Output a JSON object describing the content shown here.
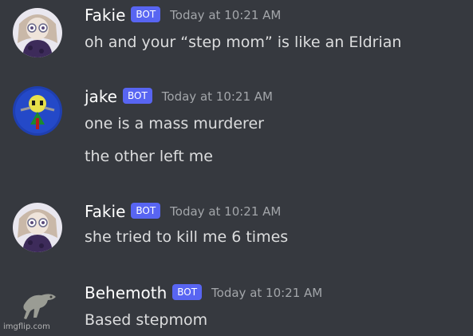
{
  "colors": {
    "background": "#36393f",
    "bot_tag": "#5865f2",
    "username": "#ffffff",
    "message_text": "#dcddde",
    "timestamp": "#a3a6aa"
  },
  "messages": [
    {
      "username": "Fakie",
      "tag": "BOT",
      "timestamp": "Today at 10:21 AM",
      "avatar": "fakie-avatar",
      "lines": [
        "oh and your “step mom” is like an Eldrian"
      ]
    },
    {
      "username": "jake",
      "tag": "BOT",
      "timestamp": "Today at 10:21 AM",
      "avatar": "jake-avatar",
      "lines": [
        "one is a mass murderer",
        "the other left me"
      ]
    },
    {
      "username": "Fakie",
      "tag": "BOT",
      "timestamp": "Today at 10:21 AM",
      "avatar": "fakie-avatar",
      "lines": [
        "she tried to kill me 6 times"
      ]
    },
    {
      "username": "Behemoth",
      "tag": "BOT",
      "timestamp": "Today at 10:21 AM",
      "avatar": "behemoth-avatar",
      "lines": [
        "Based stepmom"
      ]
    }
  ],
  "watermark": "imgflip.com"
}
